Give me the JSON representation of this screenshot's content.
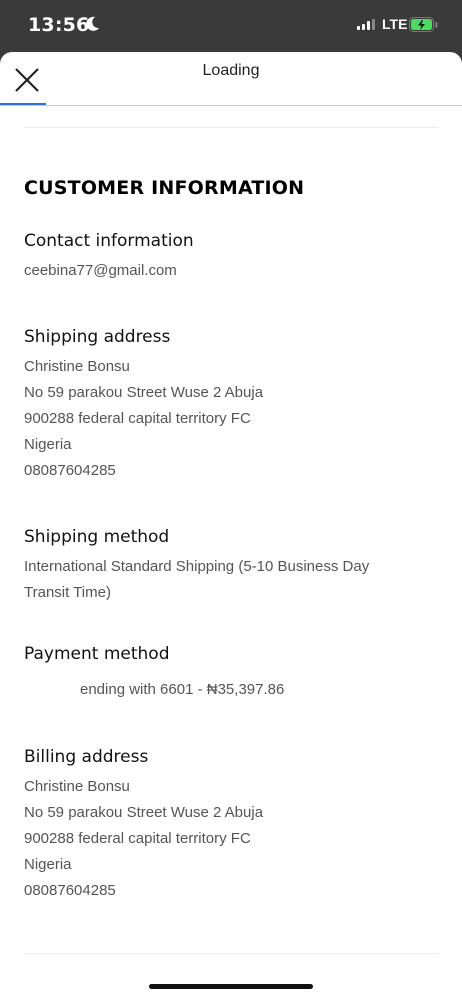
{
  "status_bar": {
    "time": "13:56",
    "network": "LTE"
  },
  "header": {
    "title": "Loading"
  },
  "customer_info": {
    "heading": "CUSTOMER INFORMATION",
    "contact": {
      "label": "Contact information",
      "email": "ceebina77@gmail.com"
    },
    "shipping_address": {
      "label": "Shipping address",
      "lines": [
        "Christine Bonsu",
        "No 59 parakou Street Wuse 2 Abuja",
        "900288 federal capital territory FC",
        "Nigeria",
        "08087604285"
      ]
    },
    "shipping_method": {
      "label": "Shipping method",
      "lines": [
        "International Standard Shipping (5-10 Business Day",
        "Transit Time)"
      ]
    },
    "payment_method": {
      "label": "Payment method",
      "detail": "ending with 6601 - ₦35,397.86"
    },
    "billing_address": {
      "label": "Billing address",
      "lines": [
        "Christine Bonsu",
        "No 59 parakou Street Wuse 2 Abuja",
        "900288 federal capital territory FC",
        "Nigeria",
        "08087604285"
      ]
    }
  },
  "colors": {
    "progress": "#2f6fdc",
    "status_bar_bg": "#3a3a3a",
    "battery_fill": "#4cd964"
  }
}
